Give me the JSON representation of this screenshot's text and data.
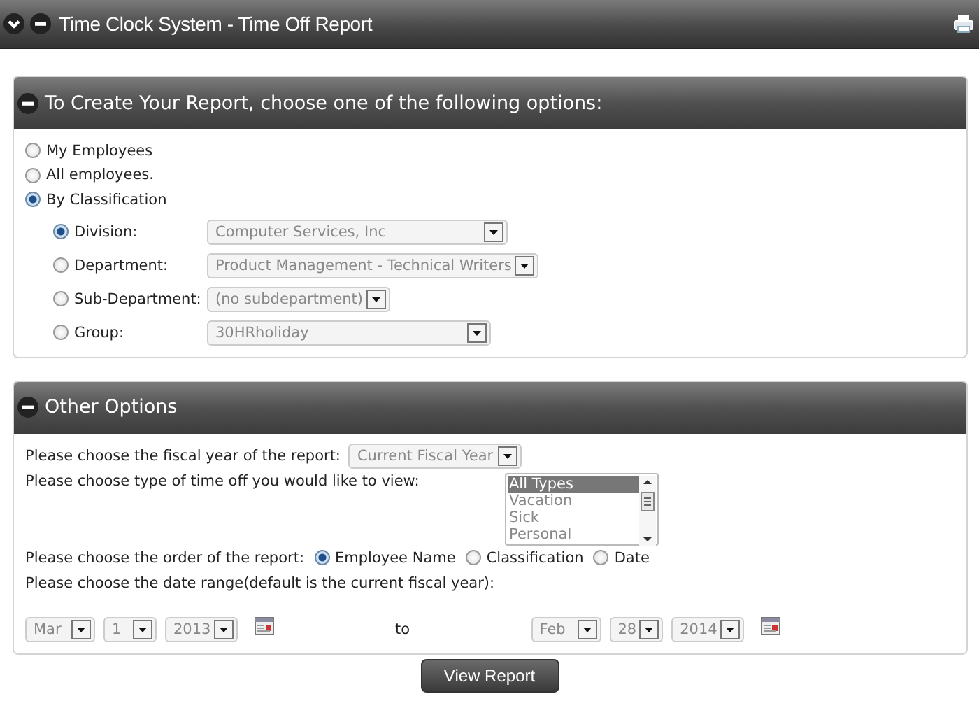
{
  "window": {
    "title": "Time Clock System - Time Off Report"
  },
  "report_scope": {
    "title": "To Create Your Report, choose one of the following options:",
    "expanded": true,
    "options": [
      {
        "label": "My Employees",
        "selected": false
      },
      {
        "label": "All employees.",
        "selected": false
      },
      {
        "label": "By Classification",
        "selected": true
      }
    ],
    "classification": [
      {
        "label": "Division:",
        "selected": true,
        "value": "Computer Services, Inc"
      },
      {
        "label": "Department:",
        "selected": false,
        "value": "Product Management - Technical Writers"
      },
      {
        "label": "Sub-Department:",
        "selected": false,
        "value": "(no subdepartment)"
      },
      {
        "label": "Group:",
        "selected": false,
        "value": "30HRholiday"
      }
    ]
  },
  "other_options": {
    "title": "Other Options",
    "expanded": true,
    "fiscal_year": {
      "label": "Please choose the fiscal year of the report:",
      "value": "Current Fiscal Year"
    },
    "time_off_type": {
      "label": "Please choose type of time off you would like to view:",
      "items": [
        {
          "label": "All Types",
          "selected": true
        },
        {
          "label": "Vacation",
          "selected": false
        },
        {
          "label": "Sick",
          "selected": false
        },
        {
          "label": "Personal",
          "selected": false
        }
      ]
    },
    "order": {
      "label": "Please choose the order of the report:",
      "options": [
        {
          "label": "Employee Name",
          "selected": true
        },
        {
          "label": "Classification",
          "selected": false
        },
        {
          "label": "Date",
          "selected": false
        }
      ]
    },
    "date_range": {
      "label": "Please choose the date range(default is the current fiscal year):",
      "from": {
        "month": "Mar",
        "day": "1",
        "year": "2013"
      },
      "separator": "to",
      "to": {
        "month": "Feb",
        "day": "28",
        "year": "2014"
      }
    }
  },
  "buttons": [
    "View Report"
  ]
}
